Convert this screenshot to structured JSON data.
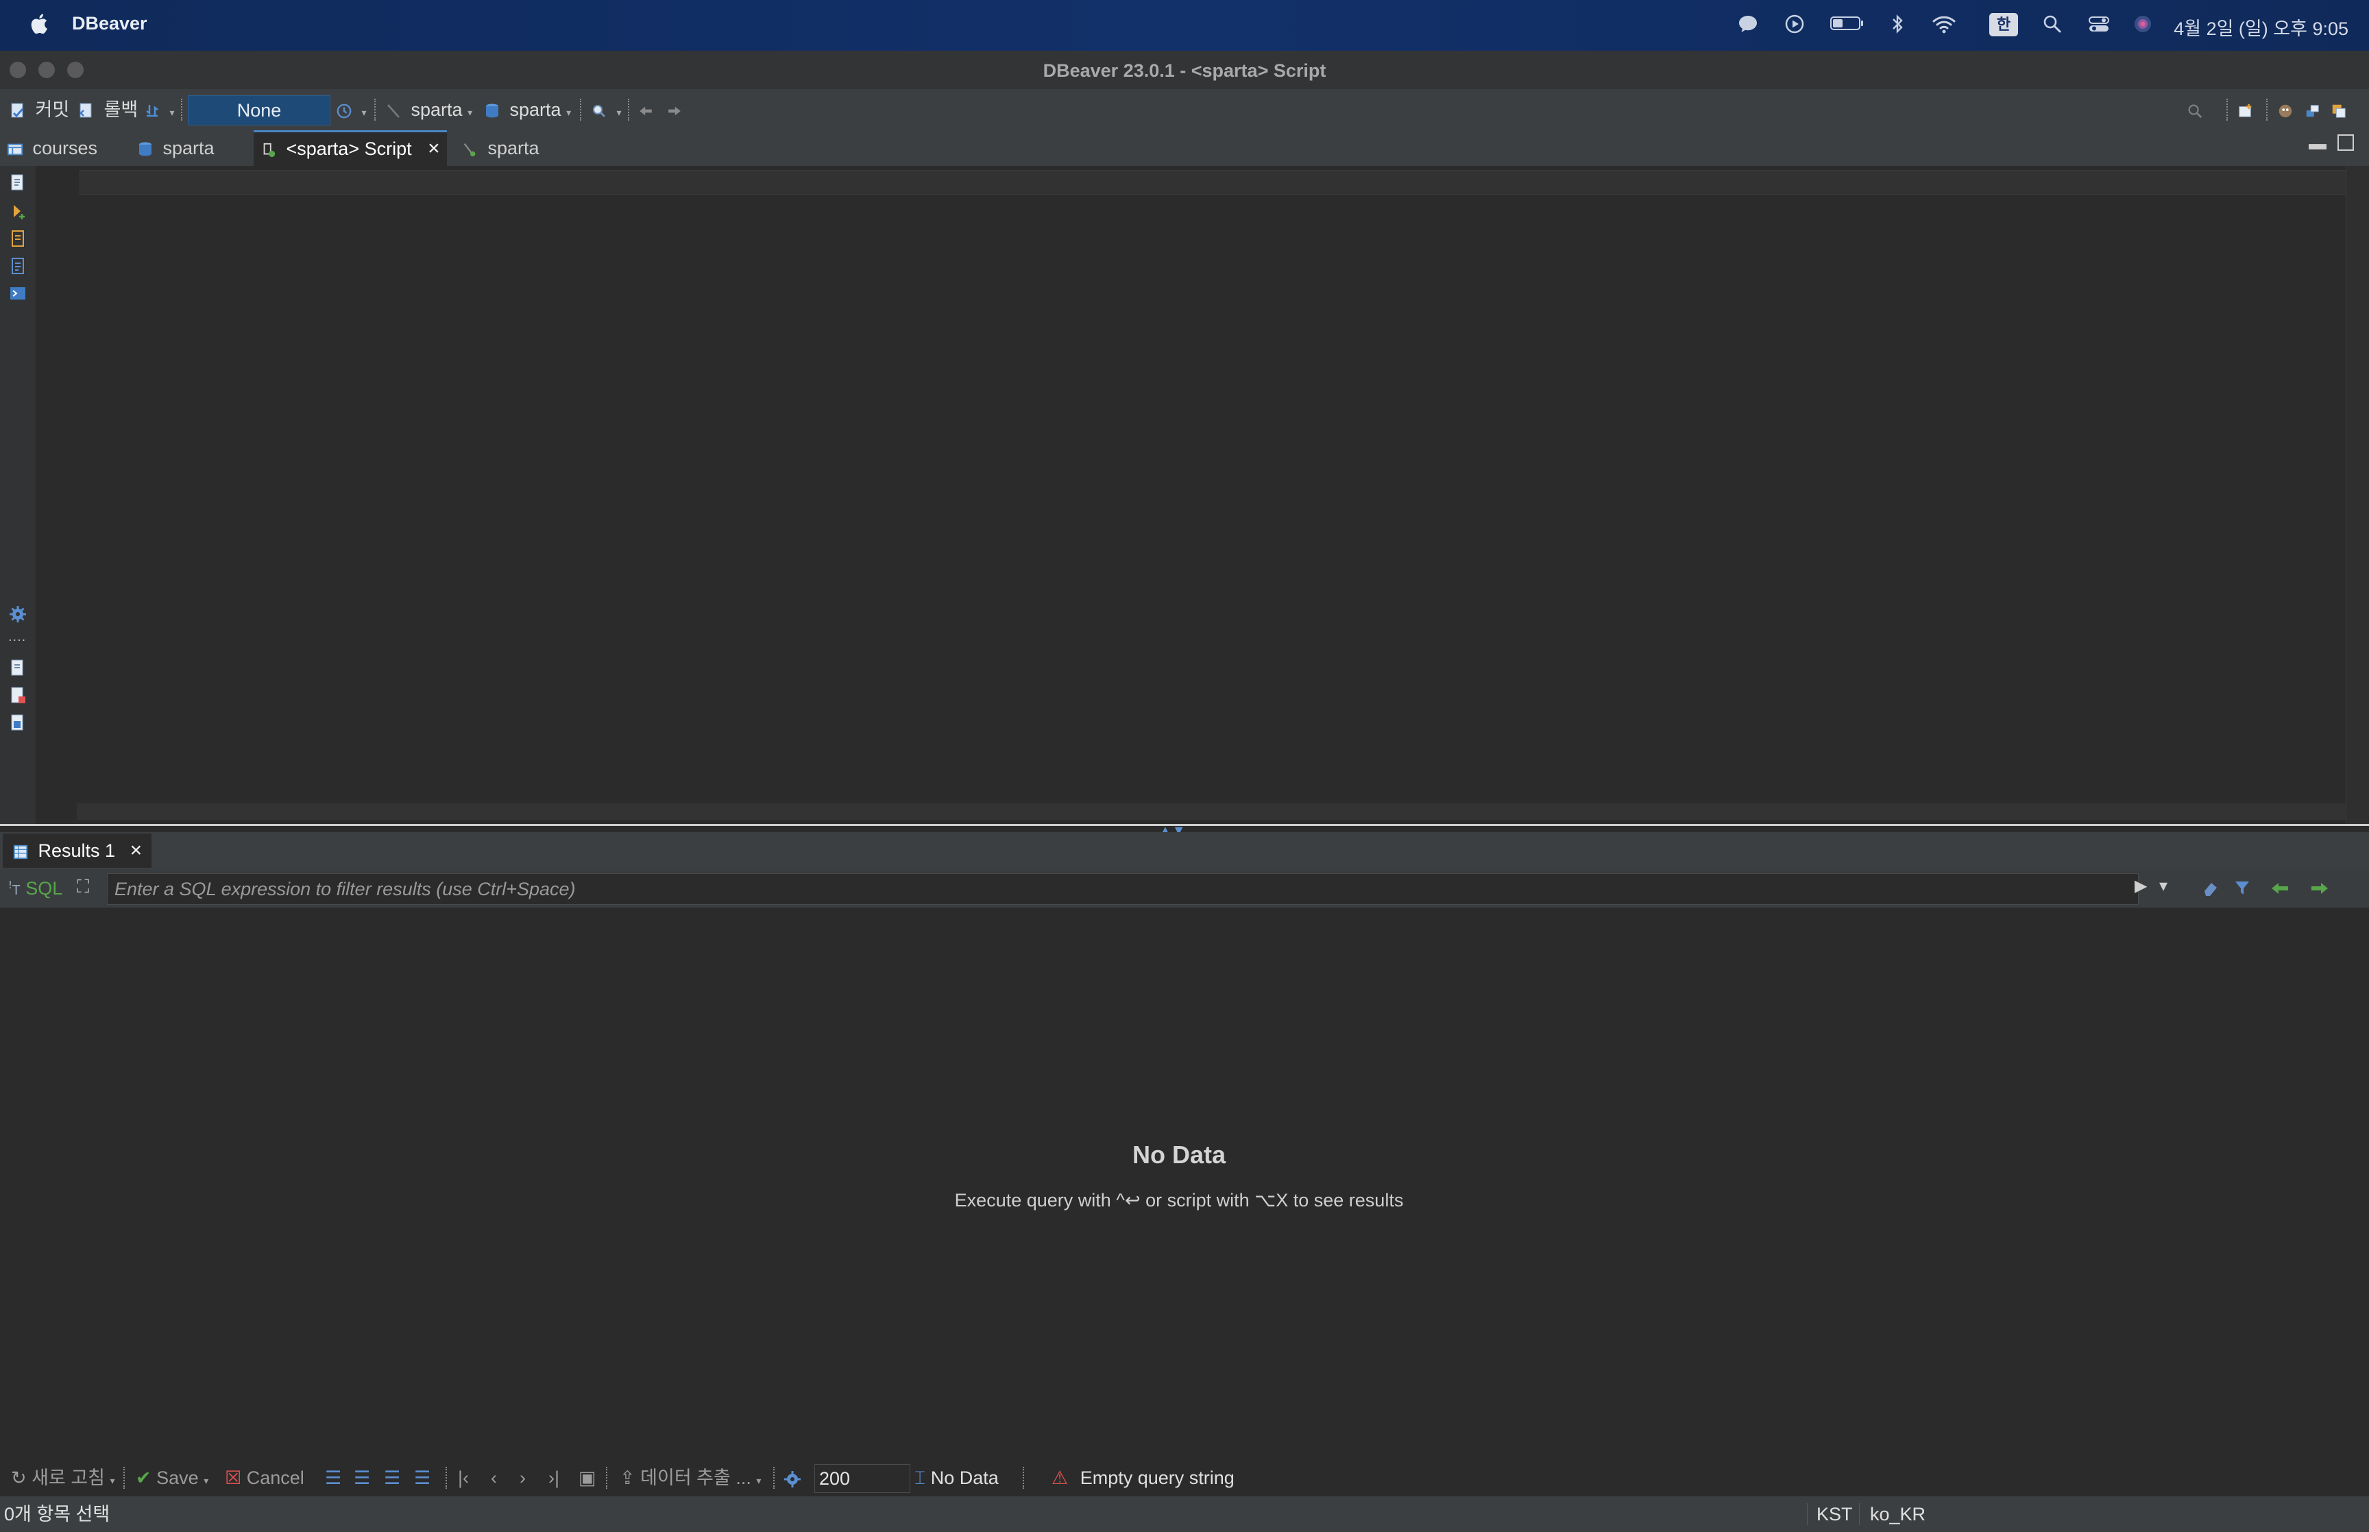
{
  "menubar": {
    "app_name": "DBeaver",
    "input_indicator": "한",
    "clock": "4월 2일 (일) 오후 9:05"
  },
  "window": {
    "title": "DBeaver 23.0.1 - <sparta> Script"
  },
  "toolbar": {
    "commit_label": "커밋",
    "rollback_label": "롤백",
    "transaction_mode": "None",
    "datasource_label": "sparta",
    "schema_label": "sparta"
  },
  "tabs": [
    {
      "label": "courses",
      "icon": "table-icon"
    },
    {
      "label": "sparta",
      "icon": "database-icon"
    },
    {
      "label": "<sparta> Script",
      "icon": "sql-script-icon",
      "active": true
    },
    {
      "label": "sparta",
      "icon": "schema-icon"
    }
  ],
  "results": {
    "tab_label": "Results 1",
    "sql_label": "SQL",
    "filter_placeholder": "Enter a SQL expression to filter results (use Ctrl+Space)",
    "no_data_title": "No Data",
    "no_data_hint": "Execute query with ^↩ or script with ⌥X to see results"
  },
  "results_toolbar": {
    "refresh_label": "새로 고침",
    "save_label": "Save",
    "cancel_label": "Cancel",
    "export_label": "데이터 추출 ...",
    "fetch_size": "200",
    "row_count_label": "No Data",
    "error_message": "Empty query string"
  },
  "statusbar": {
    "selection": "0개 항목 선택",
    "timezone": "KST",
    "locale": "ko_KR"
  },
  "colors": {
    "menubar": "#12306a",
    "accent_blue": "#4a88c7",
    "warning_red": "#e05252",
    "green": "#57a64a"
  }
}
